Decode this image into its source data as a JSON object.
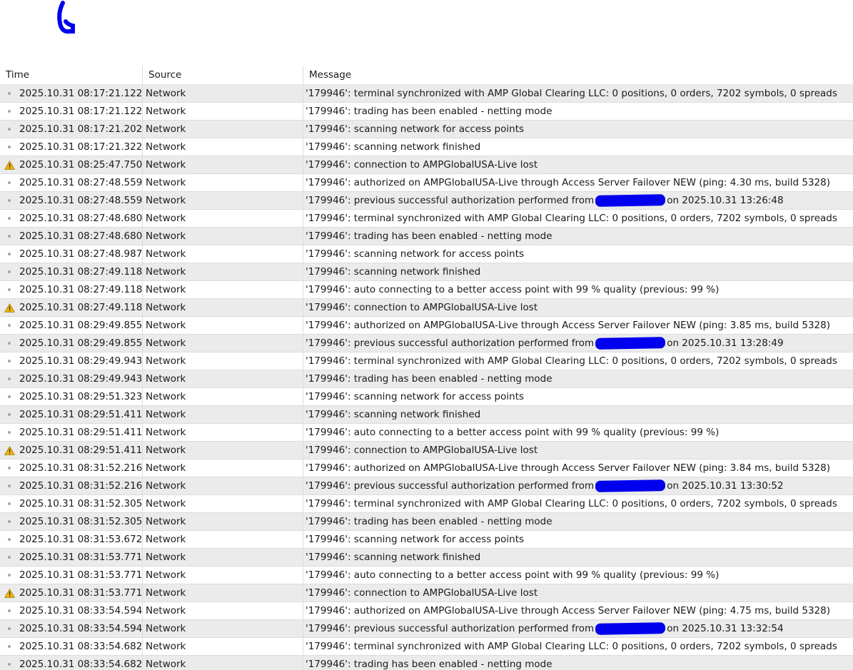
{
  "columns": {
    "time": "Time",
    "source": "Source",
    "message": "Message"
  },
  "colors": {
    "alt_row": "#ebebeb",
    "warning": "#f2b705",
    "info_dot": "#a6a6a6",
    "redaction": "#0000ee"
  },
  "rows": [
    {
      "icon": "info-dot",
      "time": "2025.10.31 08:17:21.122",
      "source": "Network",
      "message": "'179946': terminal synchronized with AMP Global Clearing LLC: 0 positions, 0 orders, 7202 symbols, 0 spreads"
    },
    {
      "icon": "info-dot",
      "time": "2025.10.31 08:17:21.122",
      "source": "Network",
      "message": "'179946': trading has been enabled - netting mode"
    },
    {
      "icon": "info-dot",
      "time": "2025.10.31 08:17:21.202",
      "source": "Network",
      "message": "'179946': scanning network for access points"
    },
    {
      "icon": "info-dot",
      "time": "2025.10.31 08:17:21.322",
      "source": "Network",
      "message": "'179946': scanning network finished"
    },
    {
      "icon": "warning-icon",
      "time": "2025.10.31 08:25:47.750",
      "source": "Network",
      "message": "'179946': connection to AMPGlobalUSA-Live lost"
    },
    {
      "icon": "info-dot",
      "time": "2025.10.31 08:27:48.559",
      "source": "Network",
      "message": "'179946': authorized on AMPGlobalUSA-Live through Access Server Failover NEW (ping: 4.30 ms, build 5328)"
    },
    {
      "icon": "info-dot",
      "time": "2025.10.31 08:27:48.559",
      "source": "Network",
      "message": "'179946': previous successful authorization performed from",
      "redacted": true,
      "message_tail": "on 2025.10.31 13:26:48"
    },
    {
      "icon": "info-dot",
      "time": "2025.10.31 08:27:48.680",
      "source": "Network",
      "message": "'179946': terminal synchronized with AMP Global Clearing LLC: 0 positions, 0 orders, 7202 symbols, 0 spreads"
    },
    {
      "icon": "info-dot",
      "time": "2025.10.31 08:27:48.680",
      "source": "Network",
      "message": "'179946': trading has been enabled - netting mode"
    },
    {
      "icon": "info-dot",
      "time": "2025.10.31 08:27:48.987",
      "source": "Network",
      "message": "'179946': scanning network for access points"
    },
    {
      "icon": "info-dot",
      "time": "2025.10.31 08:27:49.118",
      "source": "Network",
      "message": "'179946': scanning network finished"
    },
    {
      "icon": "info-dot",
      "time": "2025.10.31 08:27:49.118",
      "source": "Network",
      "message": "'179946': auto connecting to a better access point with 99 % quality (previous: 99 %)"
    },
    {
      "icon": "warning-icon",
      "time": "2025.10.31 08:27:49.118",
      "source": "Network",
      "message": "'179946': connection to AMPGlobalUSA-Live lost"
    },
    {
      "icon": "info-dot",
      "time": "2025.10.31 08:29:49.855",
      "source": "Network",
      "message": "'179946': authorized on AMPGlobalUSA-Live through Access Server Failover NEW (ping: 3.85 ms, build 5328)"
    },
    {
      "icon": "info-dot",
      "time": "2025.10.31 08:29:49.855",
      "source": "Network",
      "message": "'179946': previous successful authorization performed from",
      "redacted": true,
      "message_tail": "on 2025.10.31 13:28:49"
    },
    {
      "icon": "info-dot",
      "time": "2025.10.31 08:29:49.943",
      "source": "Network",
      "message": "'179946': terminal synchronized with AMP Global Clearing LLC: 0 positions, 0 orders, 7202 symbols, 0 spreads"
    },
    {
      "icon": "info-dot",
      "time": "2025.10.31 08:29:49.943",
      "source": "Network",
      "message": "'179946': trading has been enabled - netting mode"
    },
    {
      "icon": "info-dot",
      "time": "2025.10.31 08:29:51.323",
      "source": "Network",
      "message": "'179946': scanning network for access points"
    },
    {
      "icon": "info-dot",
      "time": "2025.10.31 08:29:51.411",
      "source": "Network",
      "message": "'179946': scanning network finished"
    },
    {
      "icon": "info-dot",
      "time": "2025.10.31 08:29:51.411",
      "source": "Network",
      "message": "'179946': auto connecting to a better access point with 99 % quality (previous: 99 %)"
    },
    {
      "icon": "warning-icon",
      "time": "2025.10.31 08:29:51.411",
      "source": "Network",
      "message": "'179946': connection to AMPGlobalUSA-Live lost"
    },
    {
      "icon": "info-dot",
      "time": "2025.10.31 08:31:52.216",
      "source": "Network",
      "message": "'179946': authorized on AMPGlobalUSA-Live through Access Server Failover NEW (ping: 3.84 ms, build 5328)"
    },
    {
      "icon": "info-dot",
      "time": "2025.10.31 08:31:52.216",
      "source": "Network",
      "message": "'179946': previous successful authorization performed from",
      "redacted": true,
      "message_tail": "on 2025.10.31 13:30:52"
    },
    {
      "icon": "info-dot",
      "time": "2025.10.31 08:31:52.305",
      "source": "Network",
      "message": "'179946': terminal synchronized with AMP Global Clearing LLC: 0 positions, 0 orders, 7202 symbols, 0 spreads"
    },
    {
      "icon": "info-dot",
      "time": "2025.10.31 08:31:52.305",
      "source": "Network",
      "message": "'179946': trading has been enabled - netting mode"
    },
    {
      "icon": "info-dot",
      "time": "2025.10.31 08:31:53.672",
      "source": "Network",
      "message": "'179946': scanning network for access points"
    },
    {
      "icon": "info-dot",
      "time": "2025.10.31 08:31:53.771",
      "source": "Network",
      "message": "'179946': scanning network finished"
    },
    {
      "icon": "info-dot",
      "time": "2025.10.31 08:31:53.771",
      "source": "Network",
      "message": "'179946': auto connecting to a better access point with 99 % quality (previous: 99 %)"
    },
    {
      "icon": "warning-icon",
      "time": "2025.10.31 08:31:53.771",
      "source": "Network",
      "message": "'179946': connection to AMPGlobalUSA-Live lost"
    },
    {
      "icon": "info-dot",
      "time": "2025.10.31 08:33:54.594",
      "source": "Network",
      "message": "'179946': authorized on AMPGlobalUSA-Live through Access Server Failover NEW (ping: 4.75 ms, build 5328)"
    },
    {
      "icon": "info-dot",
      "time": "2025.10.31 08:33:54.594",
      "source": "Network",
      "message": "'179946': previous successful authorization performed from",
      "redacted": true,
      "message_tail": "on 2025.10.31 13:32:54"
    },
    {
      "icon": "info-dot",
      "time": "2025.10.31 08:33:54.682",
      "source": "Network",
      "message": "'179946': terminal synchronized with AMP Global Clearing LLC: 0 positions, 0 orders, 7202 symbols, 0 spreads"
    },
    {
      "icon": "info-dot",
      "time": "2025.10.31 08:33:54.682",
      "source": "Network",
      "message": "'179946': trading has been enabled - netting mode"
    }
  ]
}
